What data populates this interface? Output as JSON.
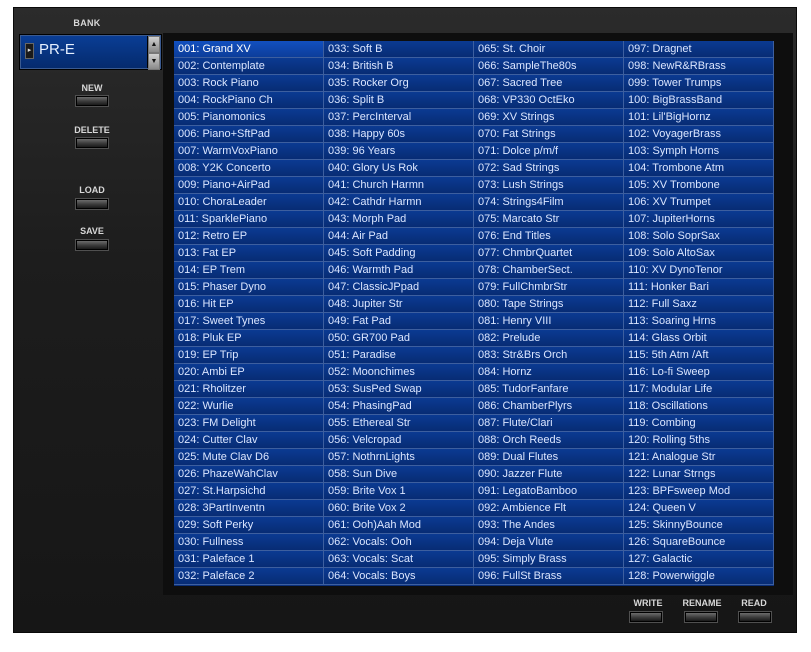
{
  "bank": {
    "title": "BANK",
    "value": "PR-E",
    "up": "▲",
    "down": "▼",
    "arrow": "▸"
  },
  "side_buttons": {
    "new": "NEW",
    "delete": "DELETE",
    "load": "LOAD",
    "save": "SAVE"
  },
  "bottom_buttons": {
    "write": "WRITE",
    "rename": "RENAME",
    "read": "READ"
  },
  "patches": [
    "001: Grand XV",
    "002: Contemplate",
    "003: Rock Piano",
    "004: RockPiano Ch",
    "005: Pianomonics",
    "006: Piano+SftPad",
    "007: WarmVoxPiano",
    "008: Y2K Concerto",
    "009: Piano+AirPad",
    "010: ChoraLeader",
    "011: SparklePiano",
    "012: Retro EP",
    "013: Fat EP",
    "014: EP Trem",
    "015: Phaser Dyno",
    "016: Hit EP",
    "017: Sweet Tynes",
    "018: Pluk EP",
    "019: EP Trip",
    "020: Ambi EP",
    "021: Rholitzer",
    "022: Wurlie",
    "023: FM Delight",
    "024: Cutter Clav",
    "025: Mute Clav D6",
    "026: PhazeWahClav",
    "027: St.Harpsichd",
    "028: 3PartInventn",
    "029: Soft Perky",
    "030: Fullness",
    "031: Paleface 1",
    "032: Paleface 2",
    "033: Soft B",
    "034: British B",
    "035: Rocker Org",
    "036: Split B",
    "037: PercInterval",
    "038: Happy 60s",
    "039: 96 Years",
    "040: Glory Us Rok",
    "041: Church Harmn",
    "042: Cathdr Harmn",
    "043: Morph Pad",
    "044: Air Pad",
    "045: Soft Padding",
    "046: Warmth Pad",
    "047: ClassicJPpad",
    "048: Jupiter Str",
    "049: Fat Pad",
    "050: GR700 Pad",
    "051: Paradise",
    "052: Moonchimes",
    "053: SusPed Swap",
    "054: PhasingPad",
    "055: Ethereal Str",
    "056: Velcropad",
    "057: NothrnLights",
    "058: Sun Dive",
    "059: Brite Vox 1",
    "060: Brite Vox 2",
    "061: Ooh)Aah Mod",
    "062: Vocals: Ooh",
    "063: Vocals: Scat",
    "064: Vocals: Boys",
    "065: St. Choir",
    "066: SampleThe80s",
    "067: Sacred Tree",
    "068: VP330 OctEko",
    "069: XV Strings",
    "070: Fat Strings",
    "071: Dolce  p/m/f",
    "072: Sad Strings",
    "073: Lush Strings",
    "074: Strings4Film",
    "075: Marcato Str",
    "076: End Titles",
    "077: ChmbrQuartet",
    "078: ChamberSect.",
    "079: FullChmbrStr",
    "080: Tape Strings",
    "081: Henry VIII",
    "082: Prelude",
    "083: Str&Brs Orch",
    "084: Hornz",
    "085: TudorFanfare",
    "086: ChamberPlyrs",
    "087: Flute/Clari",
    "088: Orch Reeds",
    "089: Dual Flutes",
    "090: Jazzer Flute",
    "091: LegatoBamboo",
    "092: Ambience Flt",
    "093: The Andes",
    "094: Deja Vlute",
    "095: Simply Brass",
    "096: FullSt Brass",
    "097: Dragnet",
    "098: NewR&RBrass",
    "099: Tower Trumps",
    "100: BigBrassBand",
    "101: Lil'BigHornz",
    "102: VoyagerBrass",
    "103: Symph Horns",
    "104: Trombone Atm",
    "105: XV Trombone",
    "106: XV Trumpet",
    "107: JupiterHorns",
    "108: Solo SoprSax",
    "109: Solo AltoSax",
    "110: XV DynoTenor",
    "111: Honker Bari",
    "112: Full Saxz",
    "113: Soaring Hrns",
    "114: Glass Orbit",
    "115: 5th Atm /Aft",
    "116: Lo-fi Sweep",
    "117: Modular Life",
    "118: Oscillations",
    "119: Combing",
    "120: Rolling 5ths",
    "121: Analogue Str",
    "122: Lunar Strngs",
    "123: BPFsweep Mod",
    "124: Queen V",
    "125: SkinnyBounce",
    "126: SquareBounce",
    "127: Galactic",
    "128: Powerwiggle"
  ],
  "selected_index": 0
}
